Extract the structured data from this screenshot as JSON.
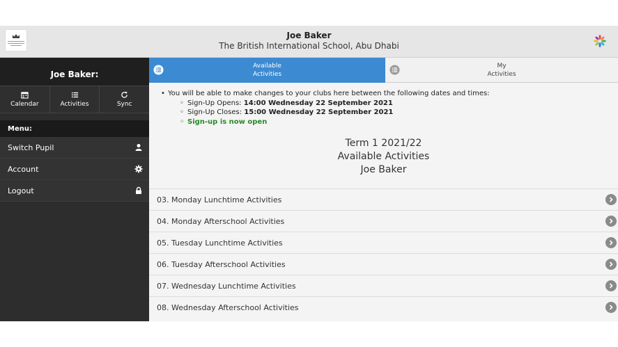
{
  "header": {
    "user_name": "Joe Baker",
    "school_name": "The British International School, Abu Dhabi"
  },
  "sidebar": {
    "user_label": "Joe Baker:",
    "tools": [
      {
        "label": "Calendar",
        "icon": "calendar-icon"
      },
      {
        "label": "Activities",
        "icon": "list-icon"
      },
      {
        "label": "Sync",
        "icon": "sync-icon"
      }
    ],
    "menu_header": "Menu:",
    "items": [
      {
        "label": "Switch Pupil",
        "icon": "user-icon"
      },
      {
        "label": "Account",
        "icon": "gear-icon"
      },
      {
        "label": "Logout",
        "icon": "lock-icon"
      }
    ]
  },
  "tabs": [
    {
      "line1": "Available",
      "line2": "Activities",
      "active": true
    },
    {
      "line1": "My",
      "line2": "Activities",
      "active": false
    }
  ],
  "signup": {
    "intro": "You will be able to make changes to your clubs here between the following dates and times:",
    "opens_label": "Sign-Up Opens:",
    "opens_value": "14:00 Wednesday 22 September 2021",
    "closes_label": "Sign-Up Closes:",
    "closes_value": "15:00 Wednesday 22 September 2021",
    "status": "Sign-up is now open"
  },
  "heading": {
    "line1": "Term 1 2021/22",
    "line2": "Available Activities",
    "line3": "Joe Baker"
  },
  "activities": [
    "03. Monday Lunchtime Activities",
    "04. Monday Afterschool Activities",
    "05. Tuesday Lunchtime Activities",
    "06. Tuesday Afterschool Activities",
    "07. Wednesday Lunchtime Activities",
    "08. Wednesday Afterschool Activities"
  ],
  "colors": {
    "accent": "#3b8ad2",
    "sidebar_bg": "#2d2d2d",
    "open_status": "#2a8a2a"
  }
}
